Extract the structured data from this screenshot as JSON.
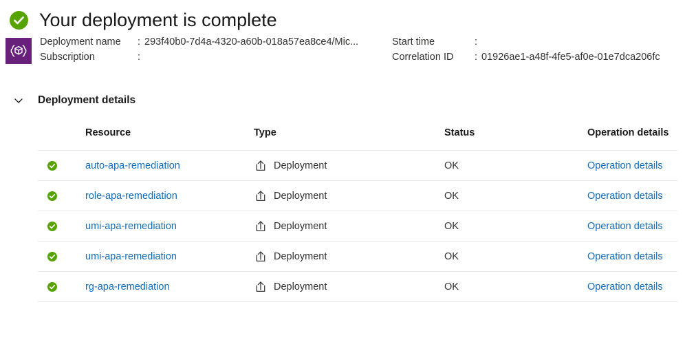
{
  "header": {
    "status_icon": "success-check-icon",
    "title": "Your deployment is complete"
  },
  "summary": {
    "resource_icon": "arm-template-icon",
    "deployment_name_label": "Deployment name",
    "deployment_name_value": "293f40b0-7d4a-4320-a60b-018a57ea8ce4/Mic...",
    "subscription_label": "Subscription",
    "subscription_value": "",
    "start_time_label": "Start time",
    "start_time_value": "",
    "correlation_id_label": "Correlation ID",
    "correlation_id_value": "01926ae1-a48f-4fe5-af0e-01e7dca206fc",
    "colon": ":"
  },
  "details_section": {
    "toggle_icon": "chevron-down-icon",
    "title": "Deployment details"
  },
  "table": {
    "columns": [
      "Resource",
      "Type",
      "Status",
      "Operation details"
    ],
    "rows": [
      {
        "status_icon": "success-check-icon",
        "resource": "auto-apa-remediation",
        "type_icon": "deployment-upload-icon",
        "type": "Deployment",
        "status": "OK",
        "operation_details": "Operation details"
      },
      {
        "status_icon": "success-check-icon",
        "resource": "role-apa-remediation",
        "type_icon": "deployment-upload-icon",
        "type": "Deployment",
        "status": "OK",
        "operation_details": "Operation details"
      },
      {
        "status_icon": "success-check-icon",
        "resource": "umi-apa-remediation",
        "type_icon": "deployment-upload-icon",
        "type": "Deployment",
        "status": "OK",
        "operation_details": "Operation details"
      },
      {
        "status_icon": "success-check-icon",
        "resource": "umi-apa-remediation",
        "type_icon": "deployment-upload-icon",
        "type": "Deployment",
        "status": "OK",
        "operation_details": "Operation details"
      },
      {
        "status_icon": "success-check-icon",
        "resource": "rg-apa-remediation",
        "type_icon": "deployment-upload-icon",
        "type": "Deployment",
        "status": "OK",
        "operation_details": "Operation details"
      }
    ]
  },
  "colors": {
    "success_green": "#57a300",
    "arm_purple": "#68217a",
    "link_blue": "#0f6cbd",
    "text_dark": "#1a1a1a",
    "divider": "#eaeaea"
  }
}
